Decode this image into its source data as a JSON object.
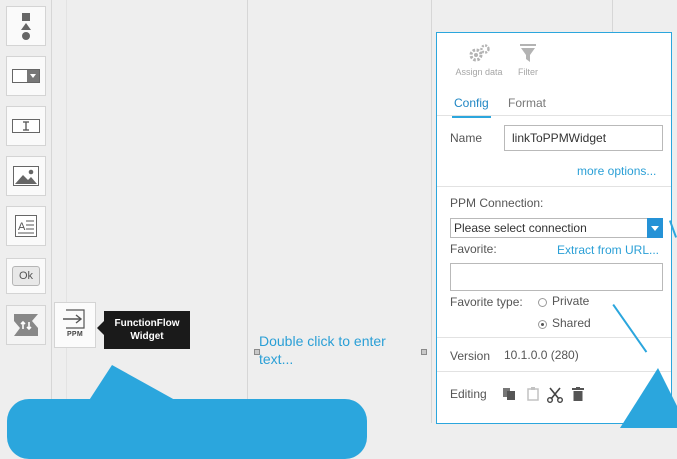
{
  "palette": {
    "tools": [
      {
        "name": "shapes-tool",
        "icon": "shapes-icon"
      },
      {
        "name": "dropdown-tool",
        "icon": "dropdown-icon"
      },
      {
        "name": "textbox-tool",
        "icon": "text-input-icon"
      },
      {
        "name": "image-tool",
        "icon": "image-icon"
      },
      {
        "name": "rich-text-tool",
        "icon": "text-block-icon"
      },
      {
        "name": "ok-button-tool",
        "icon": "ok-button-icon",
        "label": "Ok"
      },
      {
        "name": "function-flow-tool",
        "icon": "function-flow-icon"
      }
    ],
    "ppm_tool": {
      "label": "PPM",
      "icon": "arrow-into-box-icon"
    },
    "tooltip": {
      "line1": "FunctionFlow",
      "line2": "Widget"
    }
  },
  "canvas": {
    "text_widget": {
      "line1": "Double click to enter",
      "line2": "text..."
    }
  },
  "panel": {
    "tools": {
      "assign_data": "Assign data",
      "filter": "Filter"
    },
    "tabs": [
      {
        "label": "Config",
        "active": true
      },
      {
        "label": "Format",
        "active": false
      }
    ],
    "name_label": "Name",
    "name_value": "linkToPPMWidget",
    "more_options": "more options...",
    "connection_label": "PPM Connection:",
    "connection_value": "Please select connection",
    "favorite_label": "Favorite:",
    "extract_link": "Extract from URL...",
    "favorite_value": "",
    "favorite_type_label": "Favorite type:",
    "favorite_type_options": [
      {
        "label": "Private",
        "selected": false
      },
      {
        "label": "Shared",
        "selected": true
      }
    ],
    "version_label": "Version",
    "version_value": "10.1.0.0 (280)",
    "editing_label": "Editing",
    "editing_actions": [
      "copy-icon",
      "paste-icon",
      "cut-icon",
      "delete-icon"
    ]
  },
  "colors": {
    "accent": "#2ba6dd",
    "link": "#2a9fd6",
    "tooltip_bg": "#1a1a1a",
    "canvas_bg": "#eeeeee"
  }
}
